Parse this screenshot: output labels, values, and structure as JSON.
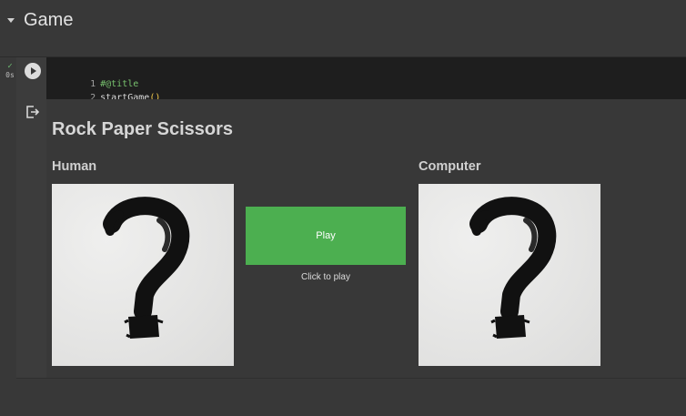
{
  "section": {
    "title": "Game"
  },
  "cell": {
    "status_time": "0s",
    "code": [
      {
        "num": "1",
        "text": "#@title"
      },
      {
        "num": "2",
        "fn": "startGame",
        "paren": "()"
      }
    ]
  },
  "game": {
    "title": "Rock Paper Scissors",
    "human": {
      "label": "Human",
      "image": "question-mark"
    },
    "computer": {
      "label": "Computer",
      "image": "question-mark"
    },
    "play_label": "Play",
    "hint": "Click to play",
    "button_color": "#4caf50"
  }
}
